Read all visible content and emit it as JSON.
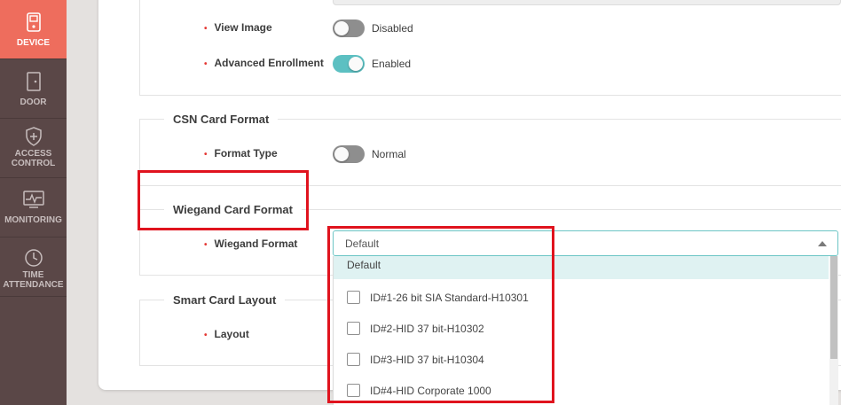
{
  "sidebar": {
    "items": [
      {
        "label": "DEVICE",
        "icon": "device-icon",
        "active": true
      },
      {
        "label": "DOOR",
        "icon": "door-icon",
        "active": false
      },
      {
        "label_line1": "ACCESS",
        "label_line2": "CONTROL",
        "icon": "shield-plus-icon",
        "active": false
      },
      {
        "label": "MONITORING",
        "icon": "monitor-pulse-icon",
        "active": false
      },
      {
        "label_line1": "TIME",
        "label_line2": "ATTENDANCE",
        "icon": "clock-icon",
        "active": false
      }
    ]
  },
  "fields": {
    "view_image": {
      "label": "View Image",
      "state": "Disabled"
    },
    "advanced_enrollment": {
      "label": "Advanced Enrollment",
      "state": "Enabled"
    }
  },
  "sections": {
    "csn": {
      "title": "CSN Card Format",
      "format_type_label": "Format Type",
      "format_type_value": "Normal"
    },
    "wiegand": {
      "title": "Wiegand Card Format",
      "format_label": "Wiegand Format",
      "selected": "Default"
    },
    "smart": {
      "title": "Smart Card Layout",
      "layout_label": "Layout"
    }
  },
  "dropdown": {
    "default_option": "Default",
    "options": [
      "ID#1-26 bit SIA Standard-H10301",
      "ID#2-HID 37 bit-H10302",
      "ID#3-HID 37 bit-H10304",
      "ID#4-HID Corporate 1000"
    ]
  },
  "colors": {
    "sidebar": "#5a4747",
    "active_nav": "#ee6d5d",
    "toggle_on": "#5cc0c2",
    "required": "#e53935",
    "highlight": "#e0131e"
  }
}
